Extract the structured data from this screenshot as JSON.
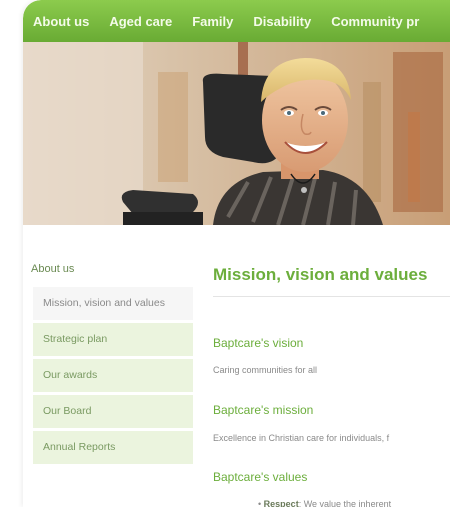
{
  "topnav": {
    "items": [
      "About us",
      "Aged care",
      "Family",
      "Disability",
      "Community pr"
    ]
  },
  "hero": {
    "description_icon": "photo-young-man-wheelchair"
  },
  "sidebar": {
    "title": "About us",
    "items": [
      {
        "label": "Mission, vision and values",
        "active": true
      },
      {
        "label": "Strategic plan"
      },
      {
        "label": "Our awards"
      },
      {
        "label": "Our Board"
      },
      {
        "label": "Annual Reports"
      }
    ]
  },
  "main": {
    "title": "Mission, vision and values",
    "sections": [
      {
        "heading": "Baptcare's vision",
        "text": "Caring communities for all"
      },
      {
        "heading": "Baptcare's mission",
        "text": "Excellence in Christian care for individuals, f"
      },
      {
        "heading": "Baptcare's values",
        "text": ""
      }
    ],
    "bullet": {
      "bold": "Respect",
      "text": ": We value the inherent"
    }
  },
  "colors": {
    "accent": "#6cae3c",
    "nav": "#7bbd43",
    "sidebar_bg": "#ebf4de"
  }
}
